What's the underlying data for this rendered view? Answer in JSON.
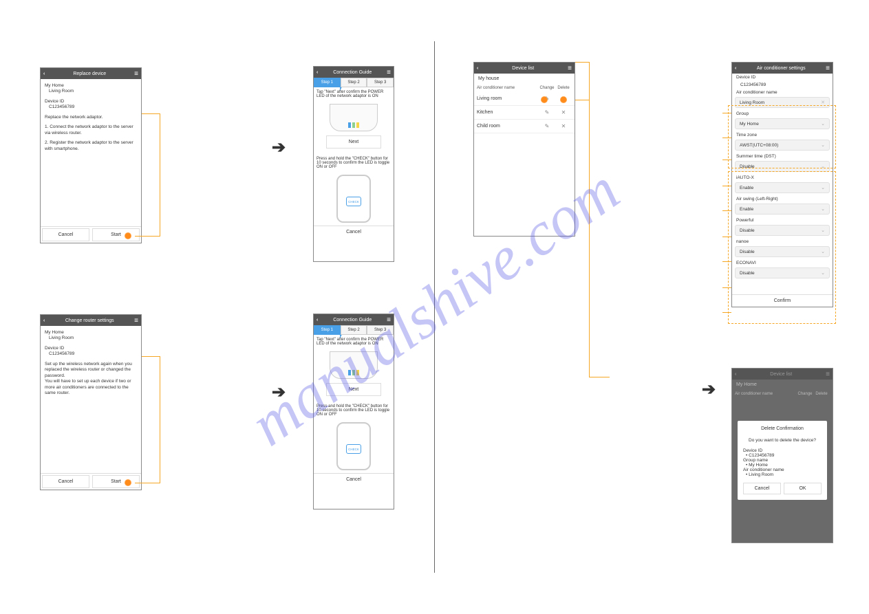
{
  "watermark": "manualshive.com",
  "common": {
    "chev": "‹",
    "hamburger": "≡",
    "cancel": "Cancel",
    "start": "Start",
    "next": "Next",
    "ok": "OK",
    "confirm": "Confirm"
  },
  "screen1": {
    "title": "Replace device",
    "myhome_lbl": "My Home",
    "room": "Living Room",
    "devid_lbl": "Device ID",
    "devid": "C123456789",
    "instr0": "Replace the network adaptor.",
    "instr1": "1. Connect the network adaptor to the server via wireless router.",
    "instr2": "2. Register the network adaptor to the server with smartphone."
  },
  "screen2": {
    "title": "Change router settings",
    "myhome_lbl": "My Home",
    "room": "Living Room",
    "devid_lbl": "Device ID",
    "devid": "C123456789",
    "para": "Set up the wireless network again when you replaced the wireless router or changed the password.\nYou will have to set up each device if two or more air conditioners are connected to the same router."
  },
  "conn_guide": {
    "title": "Connection Guide",
    "step1": "Step 1",
    "step2": "Step 2",
    "step3": "Step 3",
    "tap_next": "Tap \"Next\" after confirm the POWER LED of the network adaptor is ON",
    "hold_check": "Press and hold the \"CHECK\" button for 10 seconds to confirm the LED is toggle ON or OFF",
    "check_label": "CHECK"
  },
  "device_list": {
    "title": "Device list",
    "house": "My house",
    "col_name": "Air conditioner name",
    "col_change": "Change",
    "col_delete": "Delete",
    "rows": [
      "Living room",
      "Kitchen",
      "Child room"
    ]
  },
  "ac_settings": {
    "title": "Air conditioner settings",
    "devid_lbl": "Device ID",
    "devid": "C123456789",
    "acname_lbl": "Air conditioner name",
    "acname": "Living Room",
    "group_lbl": "Group",
    "group": "My Home",
    "tz_lbl": "Time zone",
    "tz": "AWST(UTC+08:00)",
    "dst_lbl": "Summer time (DST)",
    "dst": "Disable",
    "iauto_lbl": "iAUTO-X",
    "iauto": "Enable",
    "swing_lbl": "Air swing (Left-Right)",
    "swing": "Enable",
    "powerful_lbl": "Powerful",
    "powerful": "Disable",
    "nanoe_lbl": "nanoe",
    "nanoe": "Disable",
    "econavi_lbl": "ECONAVI",
    "econavi": "Disable"
  },
  "delete_confirm": {
    "bg_title": "Device list",
    "bg_house": "My Home",
    "bg_col_name": "Air conditioner name",
    "bg_col_change": "Change",
    "bg_col_delete": "Delete",
    "modal_title": "Delete Confirmation",
    "question": "Do you want to delete the device?",
    "devid_lbl": "Device ID",
    "devid": "• C123456789",
    "group_lbl": "Group name",
    "group": "• My Home",
    "acname_lbl": "Air conditioner name",
    "acname": "• Living Room"
  }
}
